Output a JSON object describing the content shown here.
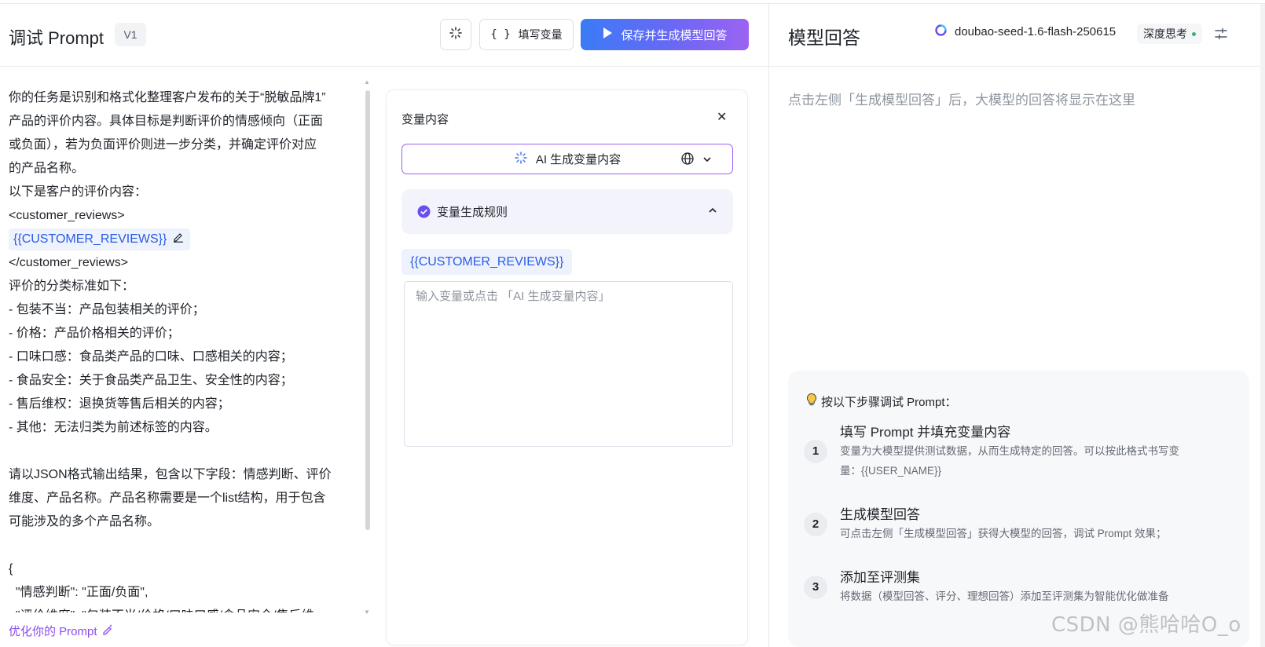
{
  "header": {
    "title": "调试 Prompt",
    "version": "V1",
    "fill_variables_label": "填写变量",
    "save_generate_label": "保存并生成模型回答"
  },
  "prompt": {
    "lines": [
      "你的任务是识别和格式化整理客户发布的关于“脱敏品牌1”",
      "产品的评价内容。具体目标是判断评价的情感倾向（正面",
      "或负面），若为负面评价则进一步分类，并确定评价对应",
      "的产品名称。",
      "以下是客户的评价内容：",
      "<customer_reviews>"
    ],
    "variable_chip": "{{CUSTOMER_REVIEWS}}",
    "lines_after": [
      "</customer_reviews>",
      "评价的分类标准如下：",
      "- 包装不当：产品包装相关的评价；",
      "- 价格：产品价格相关的评价；",
      "- 口味口感：食品类产品的口味、口感相关的内容；",
      "- 食品安全：关于食品类产品卫生、安全性的内容；",
      "- 售后维权：退换货等售后相关的内容；",
      "- 其他：无法归类为前述标签的内容。"
    ],
    "lines_json_intro": [
      "请以JSON格式输出结果，包含以下字段：情感判断、评价",
      "维度、产品名称。产品名称需要是一个list结构，用于包含",
      "可能涉及的多个产品名称。"
    ],
    "json_lines": [
      "{",
      "  \"情感判断\": \"正面/负面\",",
      "  \"评价维度\": \"包装不当/价格/口味口感/食品安全/售后维"
    ],
    "optimize_label": "优化你的 Prompt"
  },
  "variable_panel": {
    "title": "变量内容",
    "ai_generate_label": "AI 生成变量内容",
    "rule_label": "变量生成规则",
    "variable_name": "{{CUSTOMER_REVIEWS}}",
    "input_placeholder": "输入变量或点击 「AI 生成变量内容」",
    "input_value": ""
  },
  "model_panel": {
    "title": "模型回答",
    "model_name": "doubao-seed-1.6-flash-250615",
    "deep_think_label": "深度思考",
    "empty_hint": "点击左侧「生成模型回答」后，大模型的回答将显示在这里",
    "steps_heading": "按以下步骤调试 Prompt：",
    "steps": [
      {
        "num": "1",
        "title": "填写 Prompt 并填充变量内容",
        "desc_line1": "变量为大模型提供测试数据，从而生成特定的回答。可以按此格式书写变",
        "desc_line2": "量：{{USER_NAME}}"
      },
      {
        "num": "2",
        "title": "生成模型回答",
        "desc_line1": "可点击左侧「生成模型回答」获得大模型的回答，调试 Prompt 效果；",
        "desc_line2": ""
      },
      {
        "num": "3",
        "title": "添加至评测集",
        "desc_line1": "将数据（模型回答、评分、理想回答）添加至评测集为智能优化做准备",
        "desc_line2": ""
      }
    ]
  },
  "watermark": "CSDN @熊哈哈O_o",
  "colors": {
    "accent_blue": "#2a5ce6",
    "accent_purple": "#9f5ff2",
    "status_green": "#35b36b"
  }
}
